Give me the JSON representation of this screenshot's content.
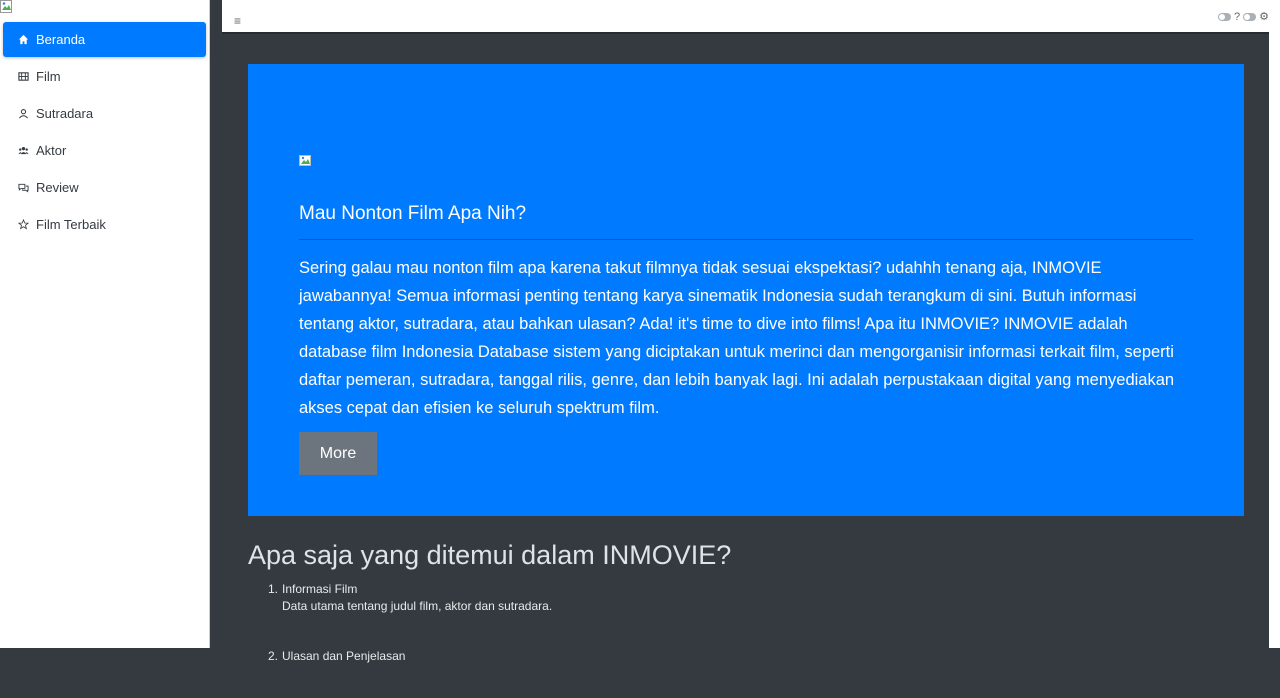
{
  "sidebar": {
    "items": [
      {
        "label": "Beranda",
        "icon": "home-icon",
        "active": true
      },
      {
        "label": "Film",
        "icon": "film-icon",
        "active": false
      },
      {
        "label": "Sutradara",
        "icon": "user-icon",
        "active": false
      },
      {
        "label": "Aktor",
        "icon": "users-icon",
        "active": false
      },
      {
        "label": "Review",
        "icon": "comments-icon",
        "active": false
      },
      {
        "label": "Film Terbaik",
        "icon": "star-icon",
        "active": false
      }
    ]
  },
  "topbar": {
    "menu_icon": "hamburger-icon",
    "help_label": "?"
  },
  "hero": {
    "title": "Mau Nonton Film Apa Nih?",
    "text": "Sering galau mau nonton film apa karena takut filmnya tidak sesuai ekspektasi? udahhh tenang aja, INMOVIE jawabannya! Semua informasi penting tentang karya sinematik Indonesia sudah terangkum di sini. Butuh informasi tentang aktor, sutradara, atau bahkan ulasan? Ada! it's time to dive into films! Apa itu INMOVIE? INMOVIE adalah database film Indonesia Database sistem yang diciptakan untuk merinci dan mengorganisir informasi terkait film, seperti daftar pemeran, sutradara, tanggal rilis, genre, dan lebih banyak lagi. Ini adalah perpustakaan digital yang menyediakan akses cepat dan efisien ke seluruh spektrum film.",
    "button_label": "More"
  },
  "features": {
    "title": "Apa saja yang ditemui dalam INMOVIE?",
    "items": [
      {
        "number": "1.",
        "title": "Informasi Film",
        "desc": "Data utama tentang judul film, aktor dan sutradara."
      },
      {
        "number": "2.",
        "title": "Ulasan dan Penjelasan",
        "desc": ""
      }
    ]
  },
  "colors": {
    "accent": "#007bff",
    "button": "#6c757d",
    "background": "#343a40"
  }
}
